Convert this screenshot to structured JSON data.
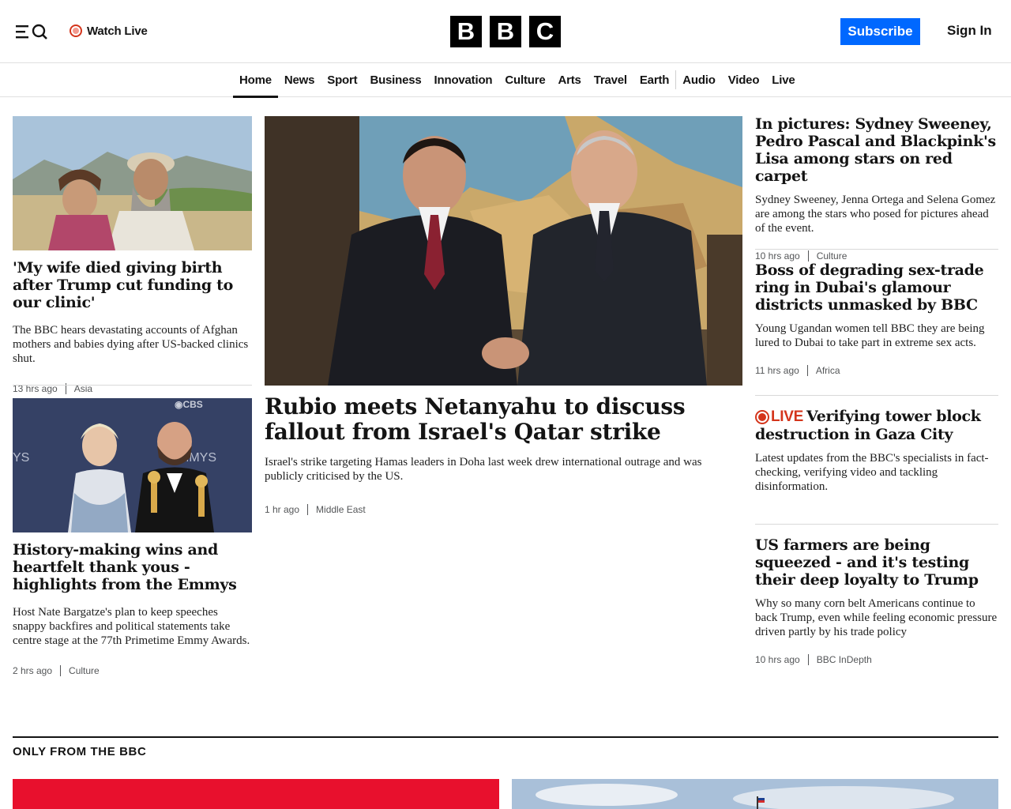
{
  "header": {
    "watch_live": "Watch Live",
    "logo_letters": [
      "B",
      "B",
      "C"
    ],
    "subscribe": "Subscribe",
    "sign_in": "Sign In",
    "colors": {
      "accent": "#0068ff",
      "live": "#d4351c"
    }
  },
  "nav": {
    "items": [
      "Home",
      "News",
      "Sport",
      "Business",
      "Innovation",
      "Culture",
      "Arts",
      "Travel",
      "Earth",
      "Audio",
      "Video",
      "Live"
    ],
    "active": "Home"
  },
  "stories": {
    "left_top": {
      "headline": "'My wife died giving birth after Trump cut funding to our clinic'",
      "summary": "The BBC hears devastating accounts of Afghan mothers and babies dying after US-backed clinics shut.",
      "time": "13 hrs ago",
      "category": "Asia"
    },
    "left_bottom": {
      "headline": "History-making wins and heartfelt thank yous - highlights from the Emmys",
      "summary": "Host Nate Bargatze's plan to keep speeches snappy backfires and political statements take centre stage at the 77th Primetime Emmy Awards.",
      "time": "2 hrs ago",
      "category": "Culture"
    },
    "lead": {
      "headline": "Rubio meets Netanyahu to discuss fallout from Israel's Qatar strike",
      "summary": "Israel's strike targeting Hamas leaders in Doha last week drew international outrage and was publicly criticised by the US.",
      "time": "1 hr ago",
      "category": "Middle East"
    },
    "right_1": {
      "headline": "In pictures: Sydney Sweeney, Pedro Pascal and Blackpink's Lisa among stars on red carpet",
      "summary": "Sydney Sweeney, Jenna Ortega and Selena Gomez are among the stars who posed for pictures ahead of the event.",
      "time": "10 hrs ago",
      "category": "Culture"
    },
    "right_2": {
      "headline": "Boss of degrading sex-trade ring in Dubai's glamour districts unmasked by BBC",
      "summary": "Young Ugandan women tell BBC they are being lured to Dubai to take part in extreme sex acts.",
      "time": "11 hrs ago",
      "category": "Africa"
    },
    "right_3": {
      "live_label": "LIVE",
      "headline": "Verifying tower block destruction in Gaza City",
      "summary": "Latest updates from the BBC's specialists in fact-checking, verifying video and tackling disinformation."
    },
    "right_4": {
      "headline": "US farmers are being squeezed - and it's testing their deep loyalty to Trump",
      "summary": "Why so many corn belt Americans continue to back Trump, even while feeling economic pressure driven partly by his trade policy",
      "time": "10 hrs ago",
      "category": "BBC InDepth"
    }
  },
  "section": {
    "title": "ONLY FROM THE BBC"
  }
}
